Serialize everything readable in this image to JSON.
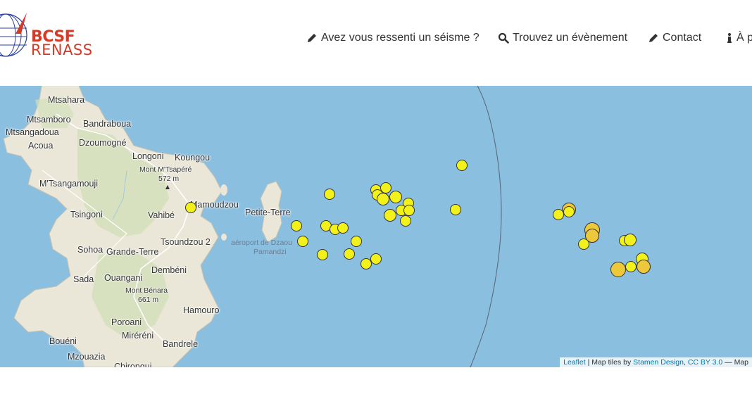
{
  "logo": {
    "line1": "BCSF",
    "line2": "RENASS"
  },
  "nav": [
    {
      "label": "Avez vous ressenti un séisme ?",
      "icon": "pencil-icon"
    },
    {
      "label": "Trouvez un évènement",
      "icon": "search-icon"
    },
    {
      "label": "Contact",
      "icon": "pencil-icon"
    },
    {
      "label": "À p",
      "icon": "info-icon"
    }
  ],
  "map": {
    "places": [
      "Mtsahara",
      "Mtsamboro",
      "Bandraboua",
      "Mtsangadoua",
      "Acoua",
      "Dzoumogné",
      "Longoni",
      "Koungou",
      "Mont M'Tsapéré",
      "572 m",
      "M'Tsangamouji",
      "Mamoudzou",
      "Tsingoni",
      "Vahibé",
      "Petite-Terre",
      "Tsoundzou 2",
      "aéroport de Dzaou",
      "Pamandzi",
      "Sohoa",
      "Grande-Terre",
      "Dembéni",
      "Sada",
      "Ouangani",
      "Mont Bénara",
      "661 m",
      "Hamouro",
      "Poroani",
      "Miréréni",
      "Bouéni",
      "Bandrele",
      "Mzouazia",
      "Chirongui"
    ],
    "quake_color": "#f2f21a",
    "quake_color_strong": "#ecc83a"
  },
  "attribution": {
    "leaflet": "Leaflet",
    "sep1": " | Map tiles by ",
    "stamen": "Stamen Design",
    "sep2": ", ",
    "license": "CC BY 3.0",
    "tail": " — Map"
  }
}
